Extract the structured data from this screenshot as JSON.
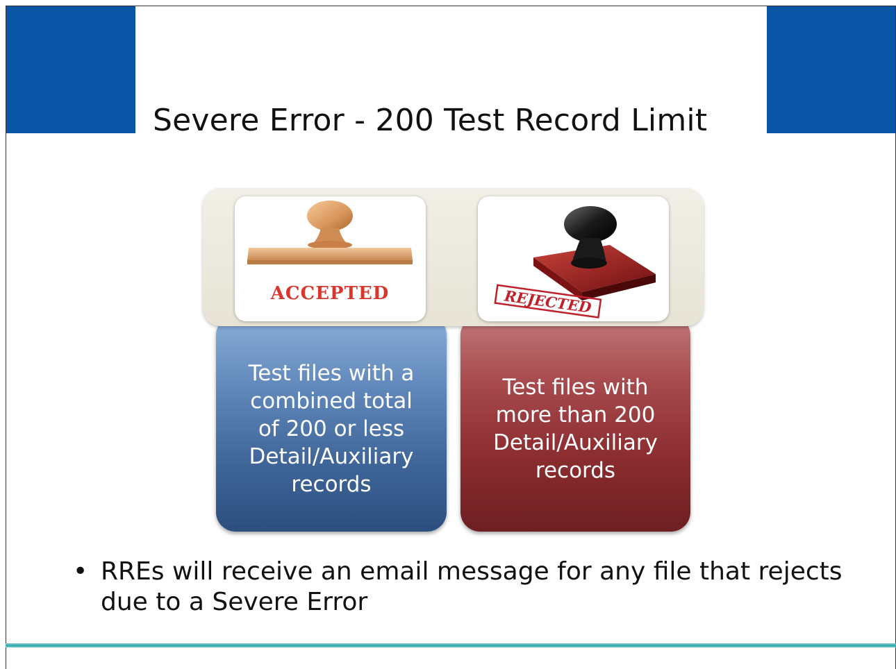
{
  "slide": {
    "title": "Severe Error - 200 Test Record Limit"
  },
  "stamps": {
    "accepted": {
      "text": "ACCEPTED",
      "icon": "wooden-rubber-stamp-icon",
      "color": "#d9362c"
    },
    "rejected": {
      "text": "REJECTED",
      "icon": "black-rubber-stamp-icon",
      "color": "#c0202a"
    }
  },
  "panels": {
    "accepted": {
      "text": "Test files with a\ncombined total\nof 200 or less\nDetail/Auxiliary\nrecords",
      "color": "#3e6497"
    },
    "rejected": {
      "text": "Test files with\nmore than 200\nDetail/Auxiliary\nrecords",
      "color": "#8c2d30"
    }
  },
  "bullets": [
    "RREs will receive an email message for any file that rejects due to a Severe Error"
  ],
  "theme": {
    "corner_blue": "#0a55a5",
    "rule_teal": "#2aa9ad"
  }
}
